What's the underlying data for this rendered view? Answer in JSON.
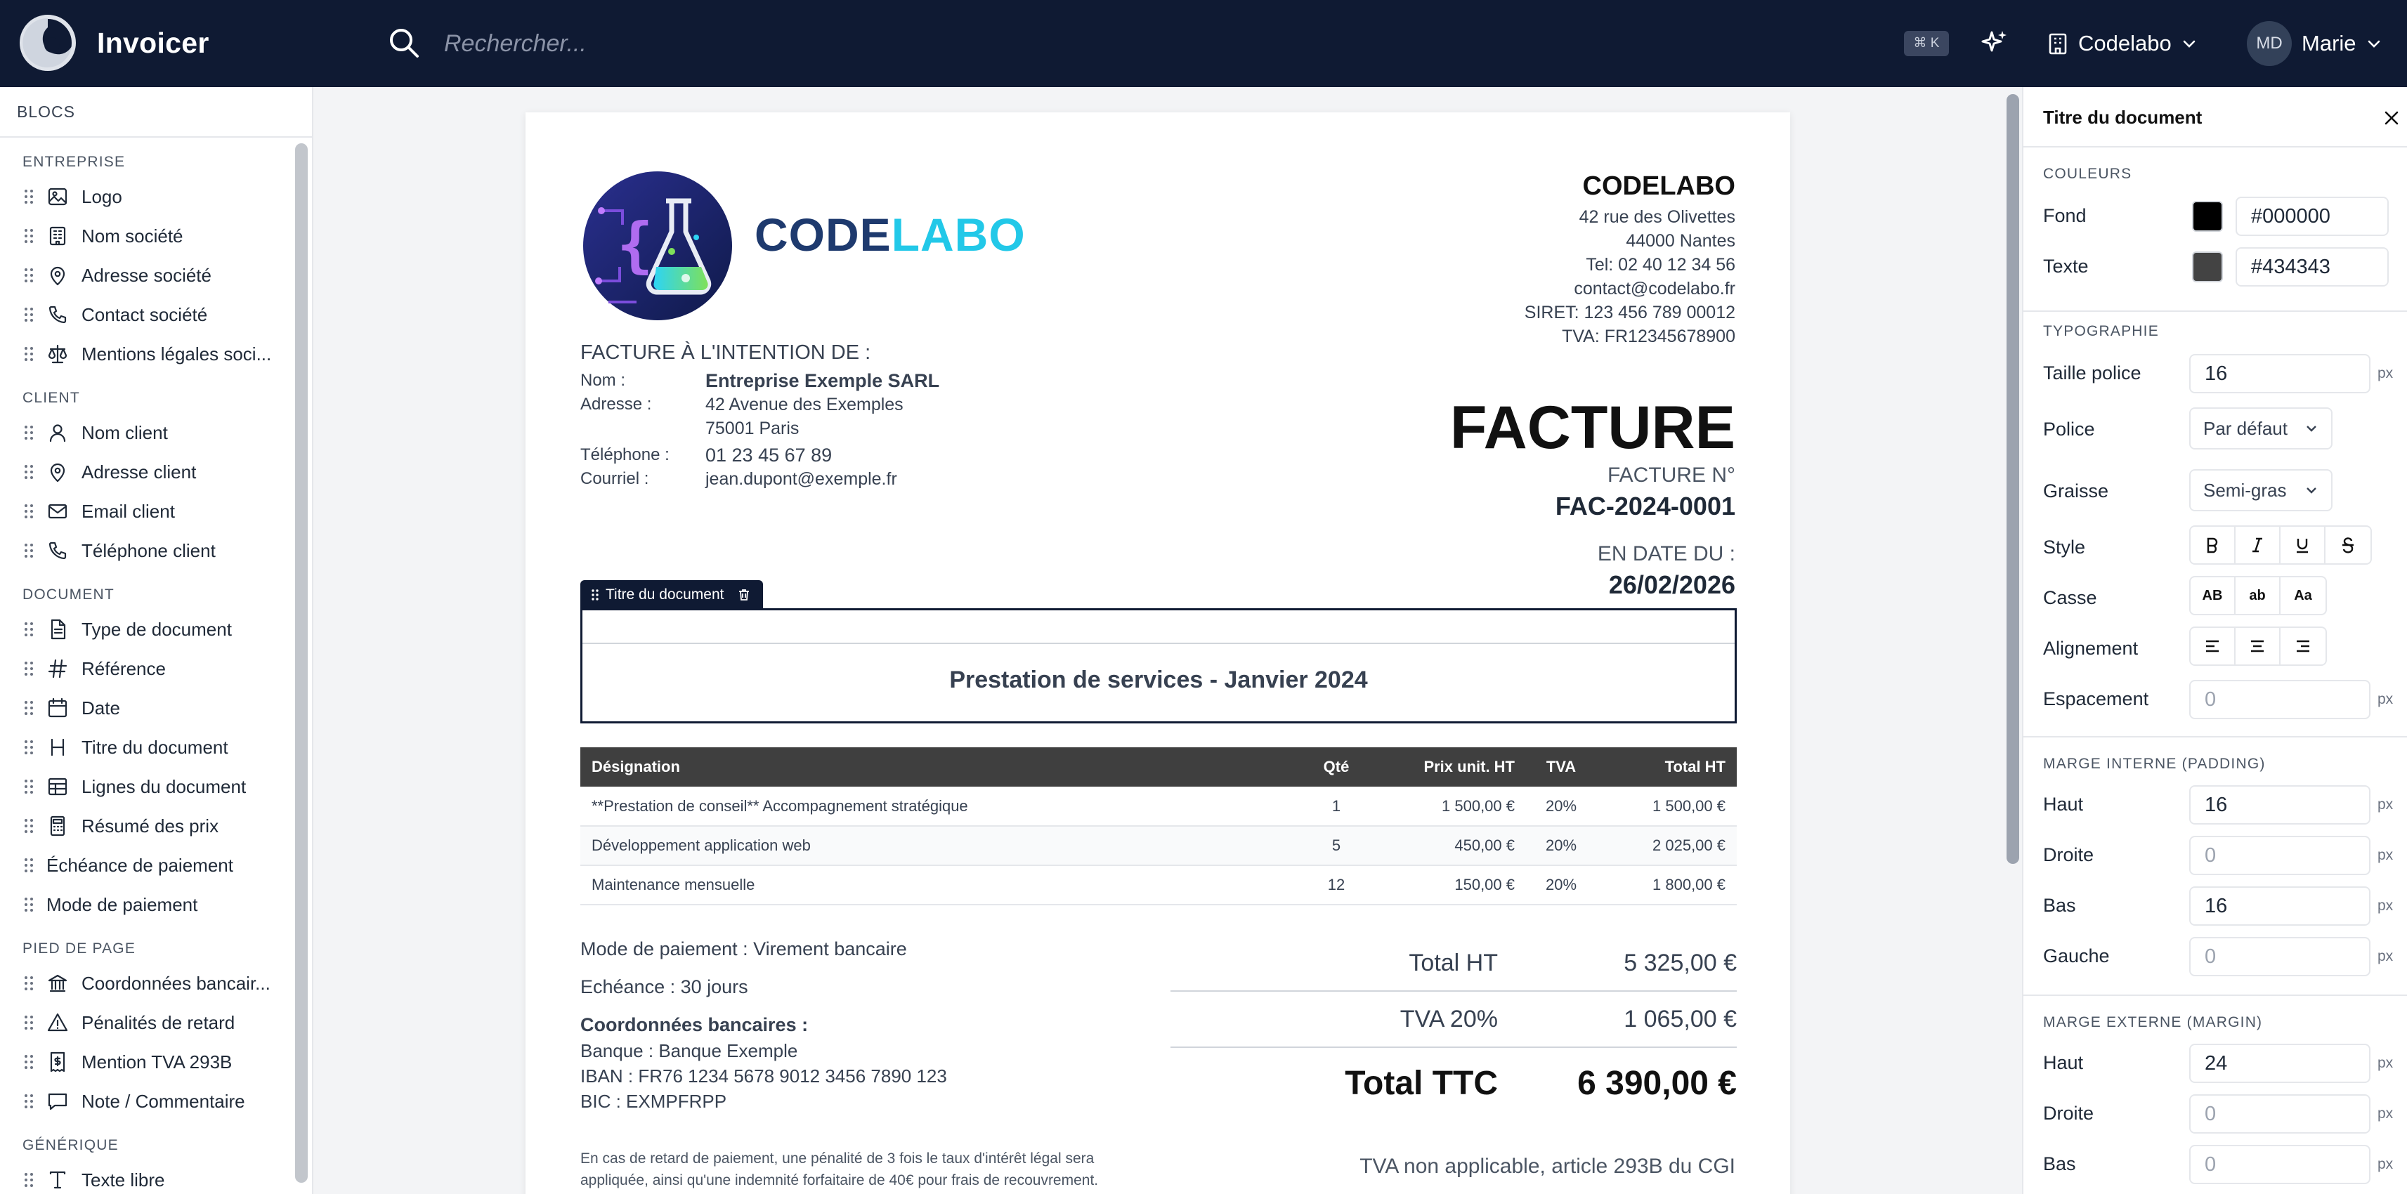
{
  "app": {
    "name": "Invoicer"
  },
  "search": {
    "placeholder": "Rechercher...",
    "shortcut": "⌘ K"
  },
  "header": {
    "org": "Codelabo",
    "user_initials": "MD",
    "user_name": "Marie"
  },
  "sidebar": {
    "title": "BLOCS",
    "sections": [
      {
        "label": "ENTREPRISE",
        "items": [
          {
            "label": "Logo",
            "icon": "image-icon"
          },
          {
            "label": "Nom société",
            "icon": "building-icon"
          },
          {
            "label": "Adresse société",
            "icon": "map-pin-icon"
          },
          {
            "label": "Contact société",
            "icon": "phone-icon"
          },
          {
            "label": "Mentions légales soci...",
            "icon": "scale-icon"
          }
        ]
      },
      {
        "label": "CLIENT",
        "items": [
          {
            "label": "Nom client",
            "icon": "user-icon"
          },
          {
            "label": "Adresse client",
            "icon": "map-pin-icon"
          },
          {
            "label": "Email client",
            "icon": "mail-icon"
          },
          {
            "label": "Téléphone client",
            "icon": "phone-icon"
          }
        ]
      },
      {
        "label": "DOCUMENT",
        "items": [
          {
            "label": "Type de document",
            "icon": "file-text-icon"
          },
          {
            "label": "Référence",
            "icon": "hash-icon"
          },
          {
            "label": "Date",
            "icon": "calendar-icon"
          },
          {
            "label": "Titre du document",
            "icon": "heading-icon"
          },
          {
            "label": "Lignes du document",
            "icon": "table-icon"
          },
          {
            "label": "Résumé des prix",
            "icon": "calculator-icon"
          },
          {
            "label": "Échéance de paiement",
            "icon": ""
          },
          {
            "label": "Mode de paiement",
            "icon": ""
          }
        ]
      },
      {
        "label": "PIED DE PAGE",
        "items": [
          {
            "label": "Coordonnées bancair...",
            "icon": "bank-icon"
          },
          {
            "label": "Pénalités de retard",
            "icon": "alert-triangle-icon"
          },
          {
            "label": "Mention TVA 293B",
            "icon": "receipt-icon"
          },
          {
            "label": "Note / Commentaire",
            "icon": "message-square-icon"
          }
        ]
      },
      {
        "label": "GÉNÉRIQUE",
        "items": [
          {
            "label": "Texte libre",
            "icon": "type-icon"
          }
        ]
      }
    ]
  },
  "invoice": {
    "company_word_1": "CODE",
    "company_word_2": "LABO",
    "company_name": "CODELABO",
    "company_address_1": "42 rue des Olivettes",
    "company_address_2": "44000 Nantes",
    "company_tel": "Tel: 02 40 12 34 56",
    "company_email": "contact@codelabo.fr",
    "company_siret": "SIRET: 123 456 789 00012",
    "company_tva": "TVA: FR12345678900",
    "client_heading": "FACTURE À L'INTENTION DE :",
    "client": {
      "name_label": "Nom :",
      "name": "Entreprise Exemple SARL",
      "address_label": "Adresse :",
      "address_1": "42 Avenue des Exemples",
      "address_2": "75001 Paris",
      "phone_label": "Téléphone :",
      "phone": "01 23 45 67 89",
      "email_label": "Courriel :",
      "email": "jean.dupont@exemple.fr"
    },
    "doc_type": "FACTURE",
    "number_label": "FACTURE N°",
    "number": "FAC-2024-0001",
    "date_label": "EN DATE DU :",
    "date": "26/02/2026",
    "selected_block_tag": "Titre du document",
    "title": "Prestation de services - Janvier 2024",
    "table_headers": {
      "designation": "Désignation",
      "qty": "Qté",
      "unit_price": "Prix unit. HT",
      "tva": "TVA",
      "total": "Total HT"
    },
    "lines": [
      {
        "designation": "**Prestation de conseil** Accompagnement stratégique",
        "qty": "1",
        "unit_price": "1 500,00 €",
        "tva": "20%",
        "total": "1 500,00 €"
      },
      {
        "designation": "Développement application web",
        "qty": "5",
        "unit_price": "450,00 €",
        "tva": "20%",
        "total": "2 025,00 €"
      },
      {
        "designation": "Maintenance mensuelle",
        "qty": "12",
        "unit_price": "150,00 €",
        "tva": "20%",
        "total": "1 800,00 €"
      }
    ],
    "payment_mode": "Mode de paiement : Virement bancaire",
    "due": "Echéance : 30 jours",
    "bank_heading": "Coordonnées bancaires :",
    "bank_name": "Banque : Banque Exemple",
    "iban": "IBAN : FR76 1234 5678 9012 3456 7890 123",
    "bic": "BIC : EXMPFRPP",
    "penalties_1": "En cas de retard de paiement, une pénalité de 3 fois le taux d'intérêt légal sera",
    "penalties_2": "appliquée, ainsi qu'une indemnité forfaitaire de 40€ pour frais de recouvrement.",
    "totals": {
      "ht_label": "Total HT",
      "ht": "5 325,00 €",
      "tva_label": "TVA 20%",
      "tva": "1 065,00 €",
      "ttc_label": "Total TTC",
      "ttc": "6 390,00 €"
    },
    "vat_note": "TVA non applicable, article 293B du CGI"
  },
  "panel": {
    "title": "Titre du document",
    "colors_section": "COULEURS",
    "bg_label": "Fond",
    "bg_value": "#000000",
    "bg_color": "#000000",
    "text_label": "Texte",
    "text_value": "#434343",
    "text_color": "#434343",
    "typo_section": "TYPOGRAPHIE",
    "size_label": "Taille police",
    "size_value": "16",
    "unit": "px",
    "font_label": "Police",
    "font_value": "Par défaut",
    "weight_label": "Graisse",
    "weight_value": "Semi-gras",
    "style_label": "Style",
    "case_label": "Casse",
    "case_options": [
      "AB",
      "ab",
      "Aa"
    ],
    "align_label": "Alignement",
    "spacing_label": "Espacement",
    "spacing_value": "0",
    "padding_section": "MARGE INTERNE (PADDING)",
    "margin_section": "MARGE EXTERNE (MARGIN)",
    "top_label": "Haut",
    "right_label": "Droite",
    "bottom_label": "Bas",
    "left_label": "Gauche",
    "padding": {
      "top": "16",
      "right": "0",
      "bottom": "16",
      "left": "0"
    },
    "margin": {
      "top": "24",
      "right": "0",
      "bottom": "0"
    }
  },
  "colors": {
    "topbar": "#0f1a33",
    "accent_blue": "#1e3a6e",
    "accent_cyan": "#22c8e8"
  }
}
